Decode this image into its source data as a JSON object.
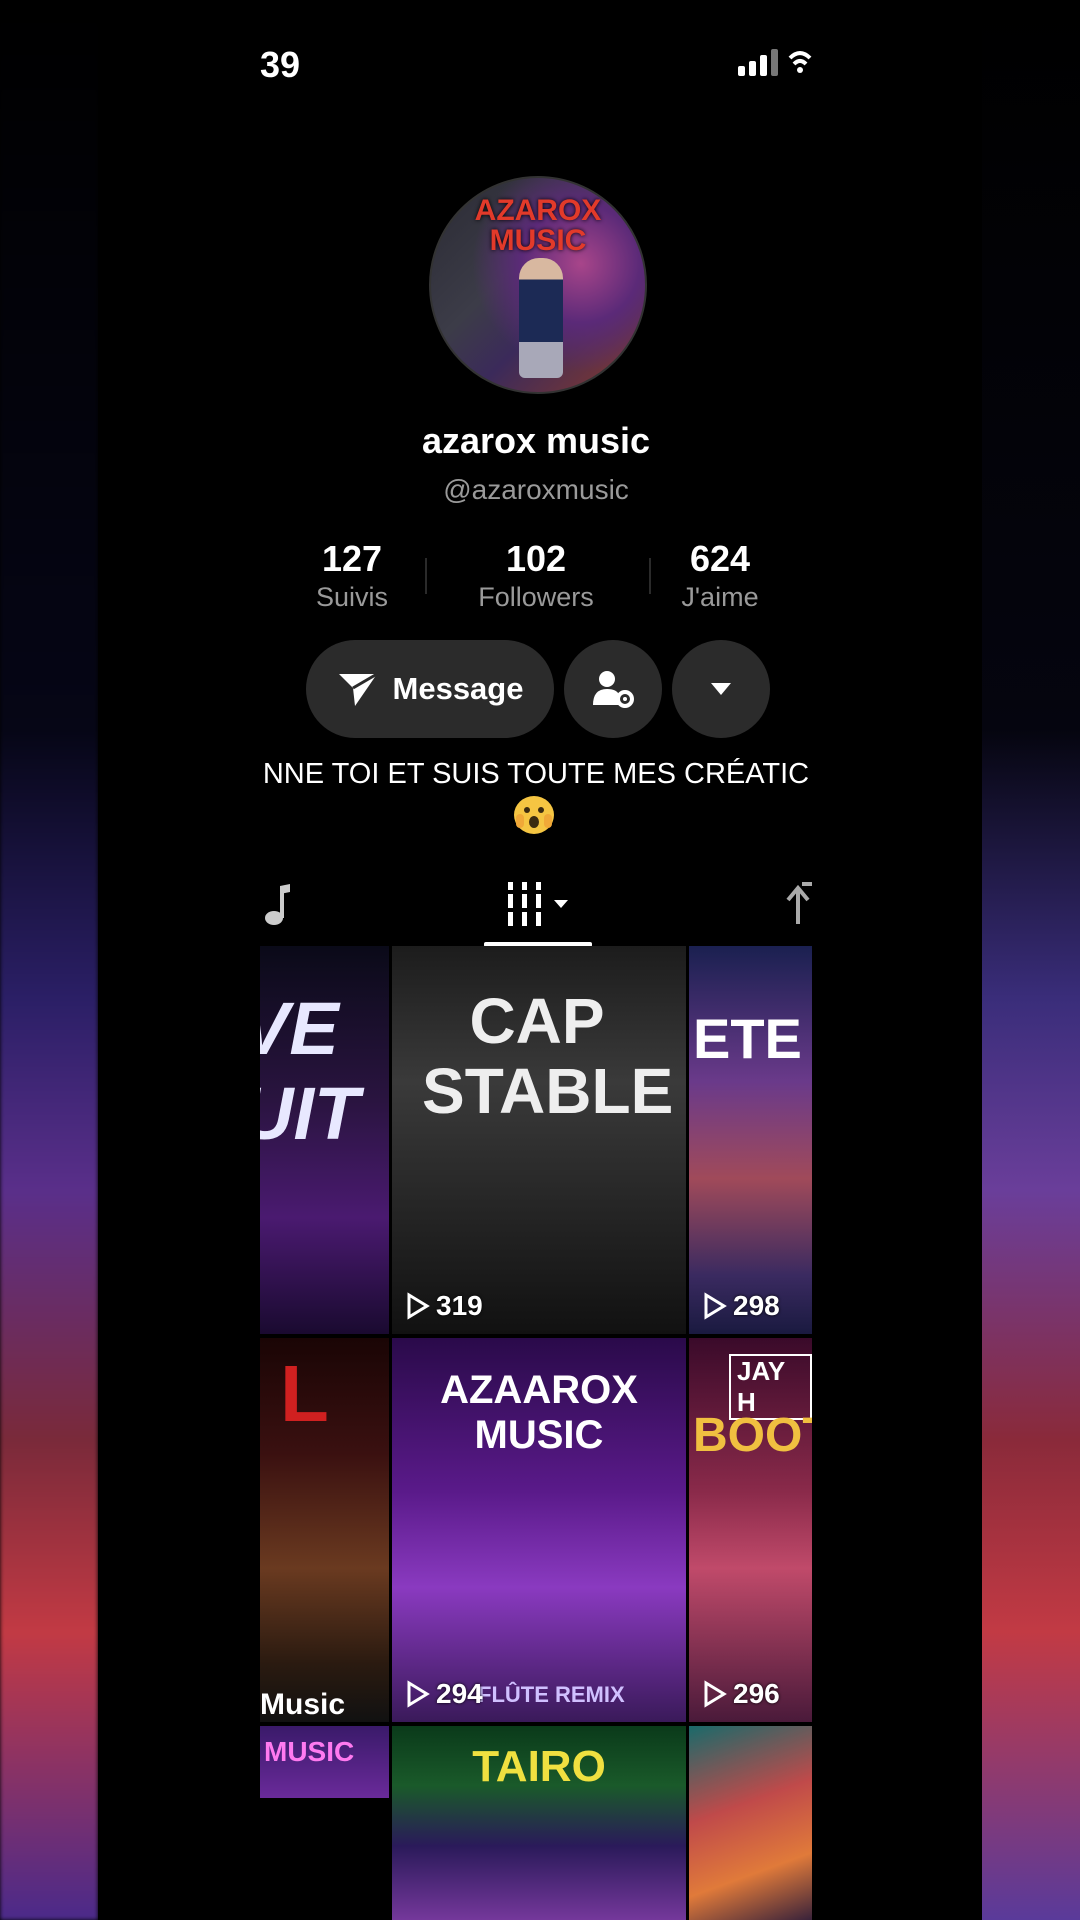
{
  "status_bar": {
    "time": "39"
  },
  "profile": {
    "avatar_text": "AZAROX MUSIC",
    "display_name": "azarox music",
    "handle": "@azaroxmusic"
  },
  "stats": [
    {
      "value": "127",
      "label": "Suivis"
    },
    {
      "value": "102",
      "label": "Followers"
    },
    {
      "value": "624",
      "label": "J'aime"
    }
  ],
  "actions": {
    "message_label": "Message"
  },
  "bio": {
    "text": "NNE TOI ET SUIS TOUTE MES CRÉATIC"
  },
  "tabs": {
    "active": "videos-grid"
  },
  "videos": [
    {
      "title": "VE UIT",
      "views": ""
    },
    {
      "title": "CAP STABLE",
      "views": "319"
    },
    {
      "title": "ETE",
      "views": "298"
    },
    {
      "title": "L",
      "subtitle": "Music",
      "views": ""
    },
    {
      "title": "AZAAROX MUSIC",
      "subtitle": "FLÛTE REMIX",
      "views": "294"
    },
    {
      "title": "BOOT",
      "badge": "JAY H",
      "views": "296"
    },
    {
      "title": "MUSIC",
      "views": ""
    },
    {
      "title": "TAIRO",
      "views": ""
    },
    {
      "title": "",
      "views": ""
    }
  ],
  "colors": {
    "background": "#000000",
    "button": "#2b2b2b",
    "muted_text": "#9a9a9a"
  }
}
